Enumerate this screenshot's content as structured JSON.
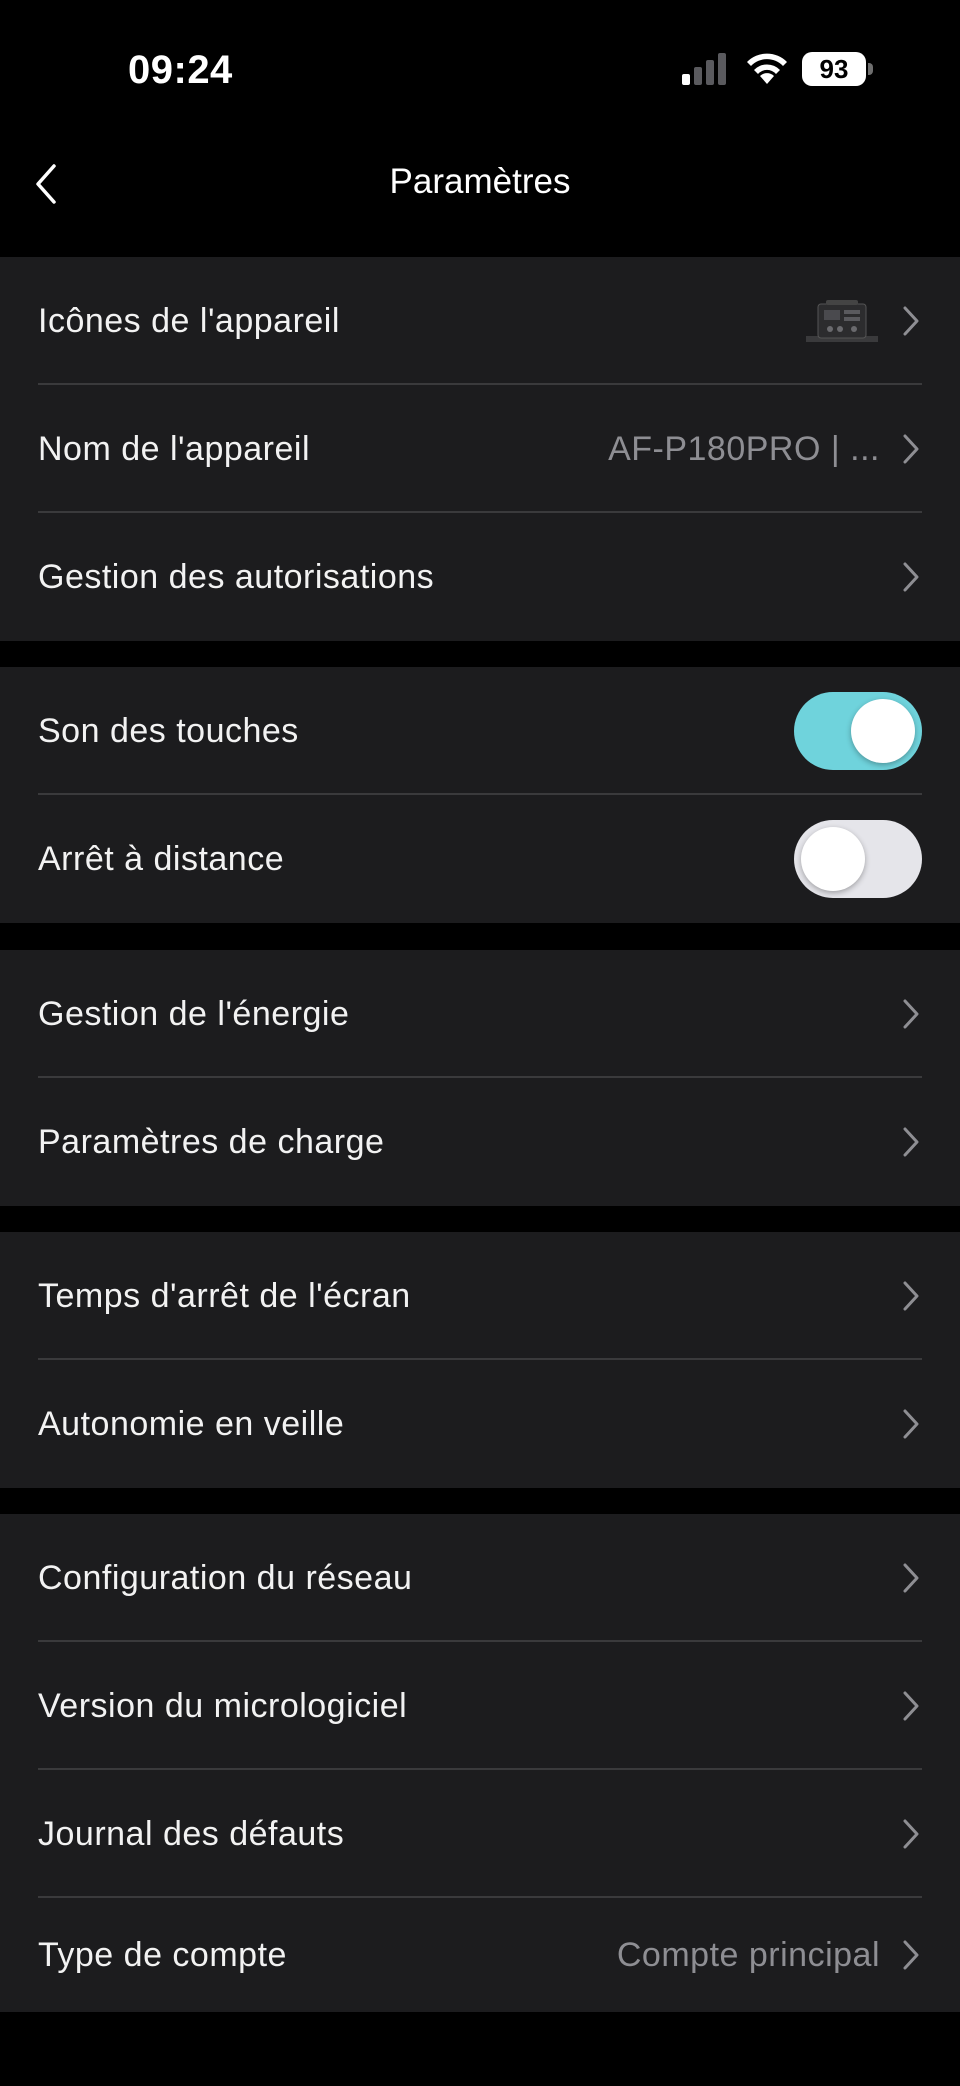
{
  "status_bar": {
    "time": "09:24",
    "battery_level": "93",
    "signal_icon": "cellular-signal-icon",
    "wifi_icon": "wifi-icon"
  },
  "nav": {
    "title": "Paramètres",
    "back_icon": "chevron-left-icon"
  },
  "groups": [
    {
      "rows": [
        {
          "label": "Icônes de l'appareil",
          "type": "link",
          "has_thumbnail": true
        },
        {
          "label": "Nom de l'appareil",
          "type": "link",
          "value": "AF-P180PRO | ..."
        },
        {
          "label": "Gestion des autorisations",
          "type": "link"
        }
      ]
    },
    {
      "rows": [
        {
          "label": "Son des touches",
          "type": "toggle",
          "checked": true
        },
        {
          "label": "Arrêt à distance",
          "type": "toggle",
          "checked": false
        }
      ]
    },
    {
      "rows": [
        {
          "label": "Gestion de l'énergie",
          "type": "link"
        },
        {
          "label": "Paramètres de charge",
          "type": "link"
        }
      ]
    },
    {
      "rows": [
        {
          "label": "Temps d'arrêt de l'écran",
          "type": "link"
        },
        {
          "label": "Autonomie en veille",
          "type": "link"
        }
      ]
    },
    {
      "rows": [
        {
          "label": "Configuration du réseau",
          "type": "link"
        },
        {
          "label": "Version du micrologiciel",
          "type": "link"
        },
        {
          "label": "Journal des défauts",
          "type": "link"
        },
        {
          "label": "Type de compte",
          "type": "link",
          "value": "Compte principal"
        }
      ]
    }
  ],
  "colors": {
    "background": "#000000",
    "group_background": "#1c1c1e",
    "divider": "#3a3a3c",
    "toggle_on": "#6fd3dc",
    "toggle_off": "#e5e5ea",
    "secondary_text": "#8e8e93"
  }
}
